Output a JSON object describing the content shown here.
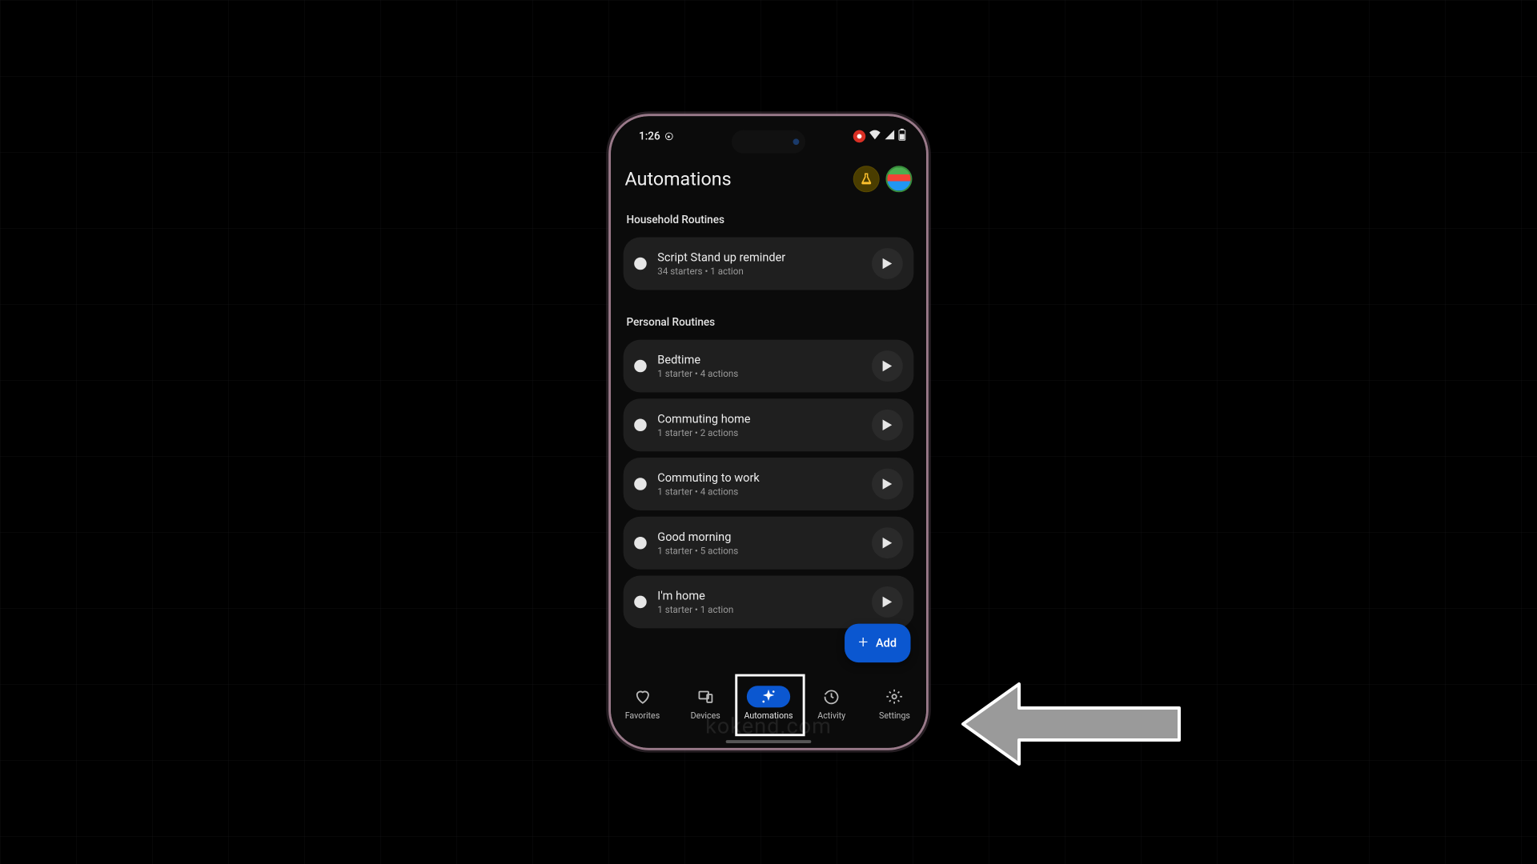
{
  "status": {
    "time": "1:26"
  },
  "header": {
    "title": "Automations"
  },
  "sections": {
    "household": {
      "title": "Household Routines",
      "items": [
        {
          "title": "Script Stand up reminder",
          "sub": "34 starters • 1 action"
        }
      ]
    },
    "personal": {
      "title": "Personal Routines",
      "items": [
        {
          "title": "Bedtime",
          "sub": "1 starter • 4 actions"
        },
        {
          "title": "Commuting home",
          "sub": "1 starter • 2 actions"
        },
        {
          "title": "Commuting to work",
          "sub": "1 starter • 4 actions"
        },
        {
          "title": "Good morning",
          "sub": "1 starter • 5 actions"
        },
        {
          "title": "I'm home",
          "sub": "1 starter • 1 action"
        }
      ]
    }
  },
  "fab": {
    "label": "Add"
  },
  "nav": {
    "items": [
      {
        "label": "Favorites"
      },
      {
        "label": "Devices"
      },
      {
        "label": "Automations"
      },
      {
        "label": "Activity"
      },
      {
        "label": "Settings"
      }
    ],
    "active_index": 2
  },
  "watermark": "kokend.com",
  "colors": {
    "accent": "#0b57d0"
  }
}
